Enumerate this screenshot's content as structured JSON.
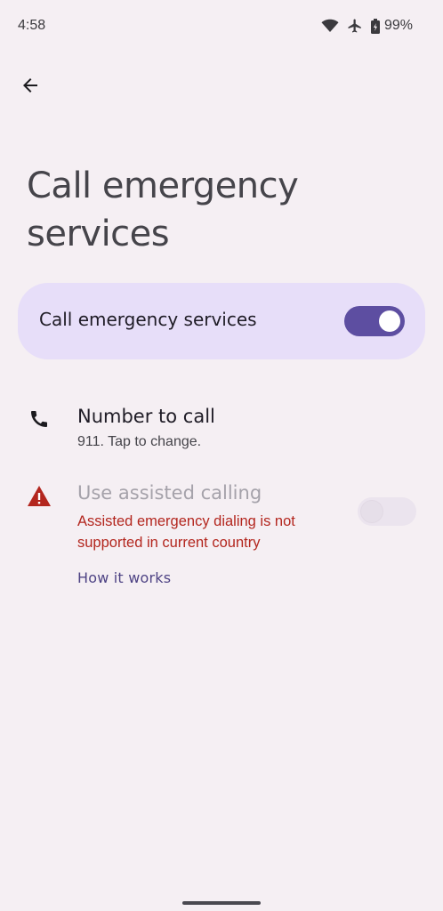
{
  "status_bar": {
    "time": "4:58",
    "battery_percent": "99%",
    "icons": [
      "wifi-icon",
      "airplane-icon",
      "battery-icon"
    ]
  },
  "page": {
    "title": "Call emergency services"
  },
  "main_switch": {
    "label": "Call emergency services",
    "state": "on"
  },
  "number_to_call": {
    "icon": "phone-icon",
    "title": "Number to call",
    "subtitle": "911. Tap to change."
  },
  "assisted_calling": {
    "icon": "warning-icon",
    "title": "Use assisted calling",
    "error": "Assisted emergency dialing is not supported in current country",
    "state": "off-disabled",
    "link_label": "How it works"
  },
  "colors": {
    "background": "#f5eff3",
    "card": "#e7def9",
    "accent": "#5d4ea1",
    "error": "#b3261e",
    "link": "#4e4384"
  }
}
